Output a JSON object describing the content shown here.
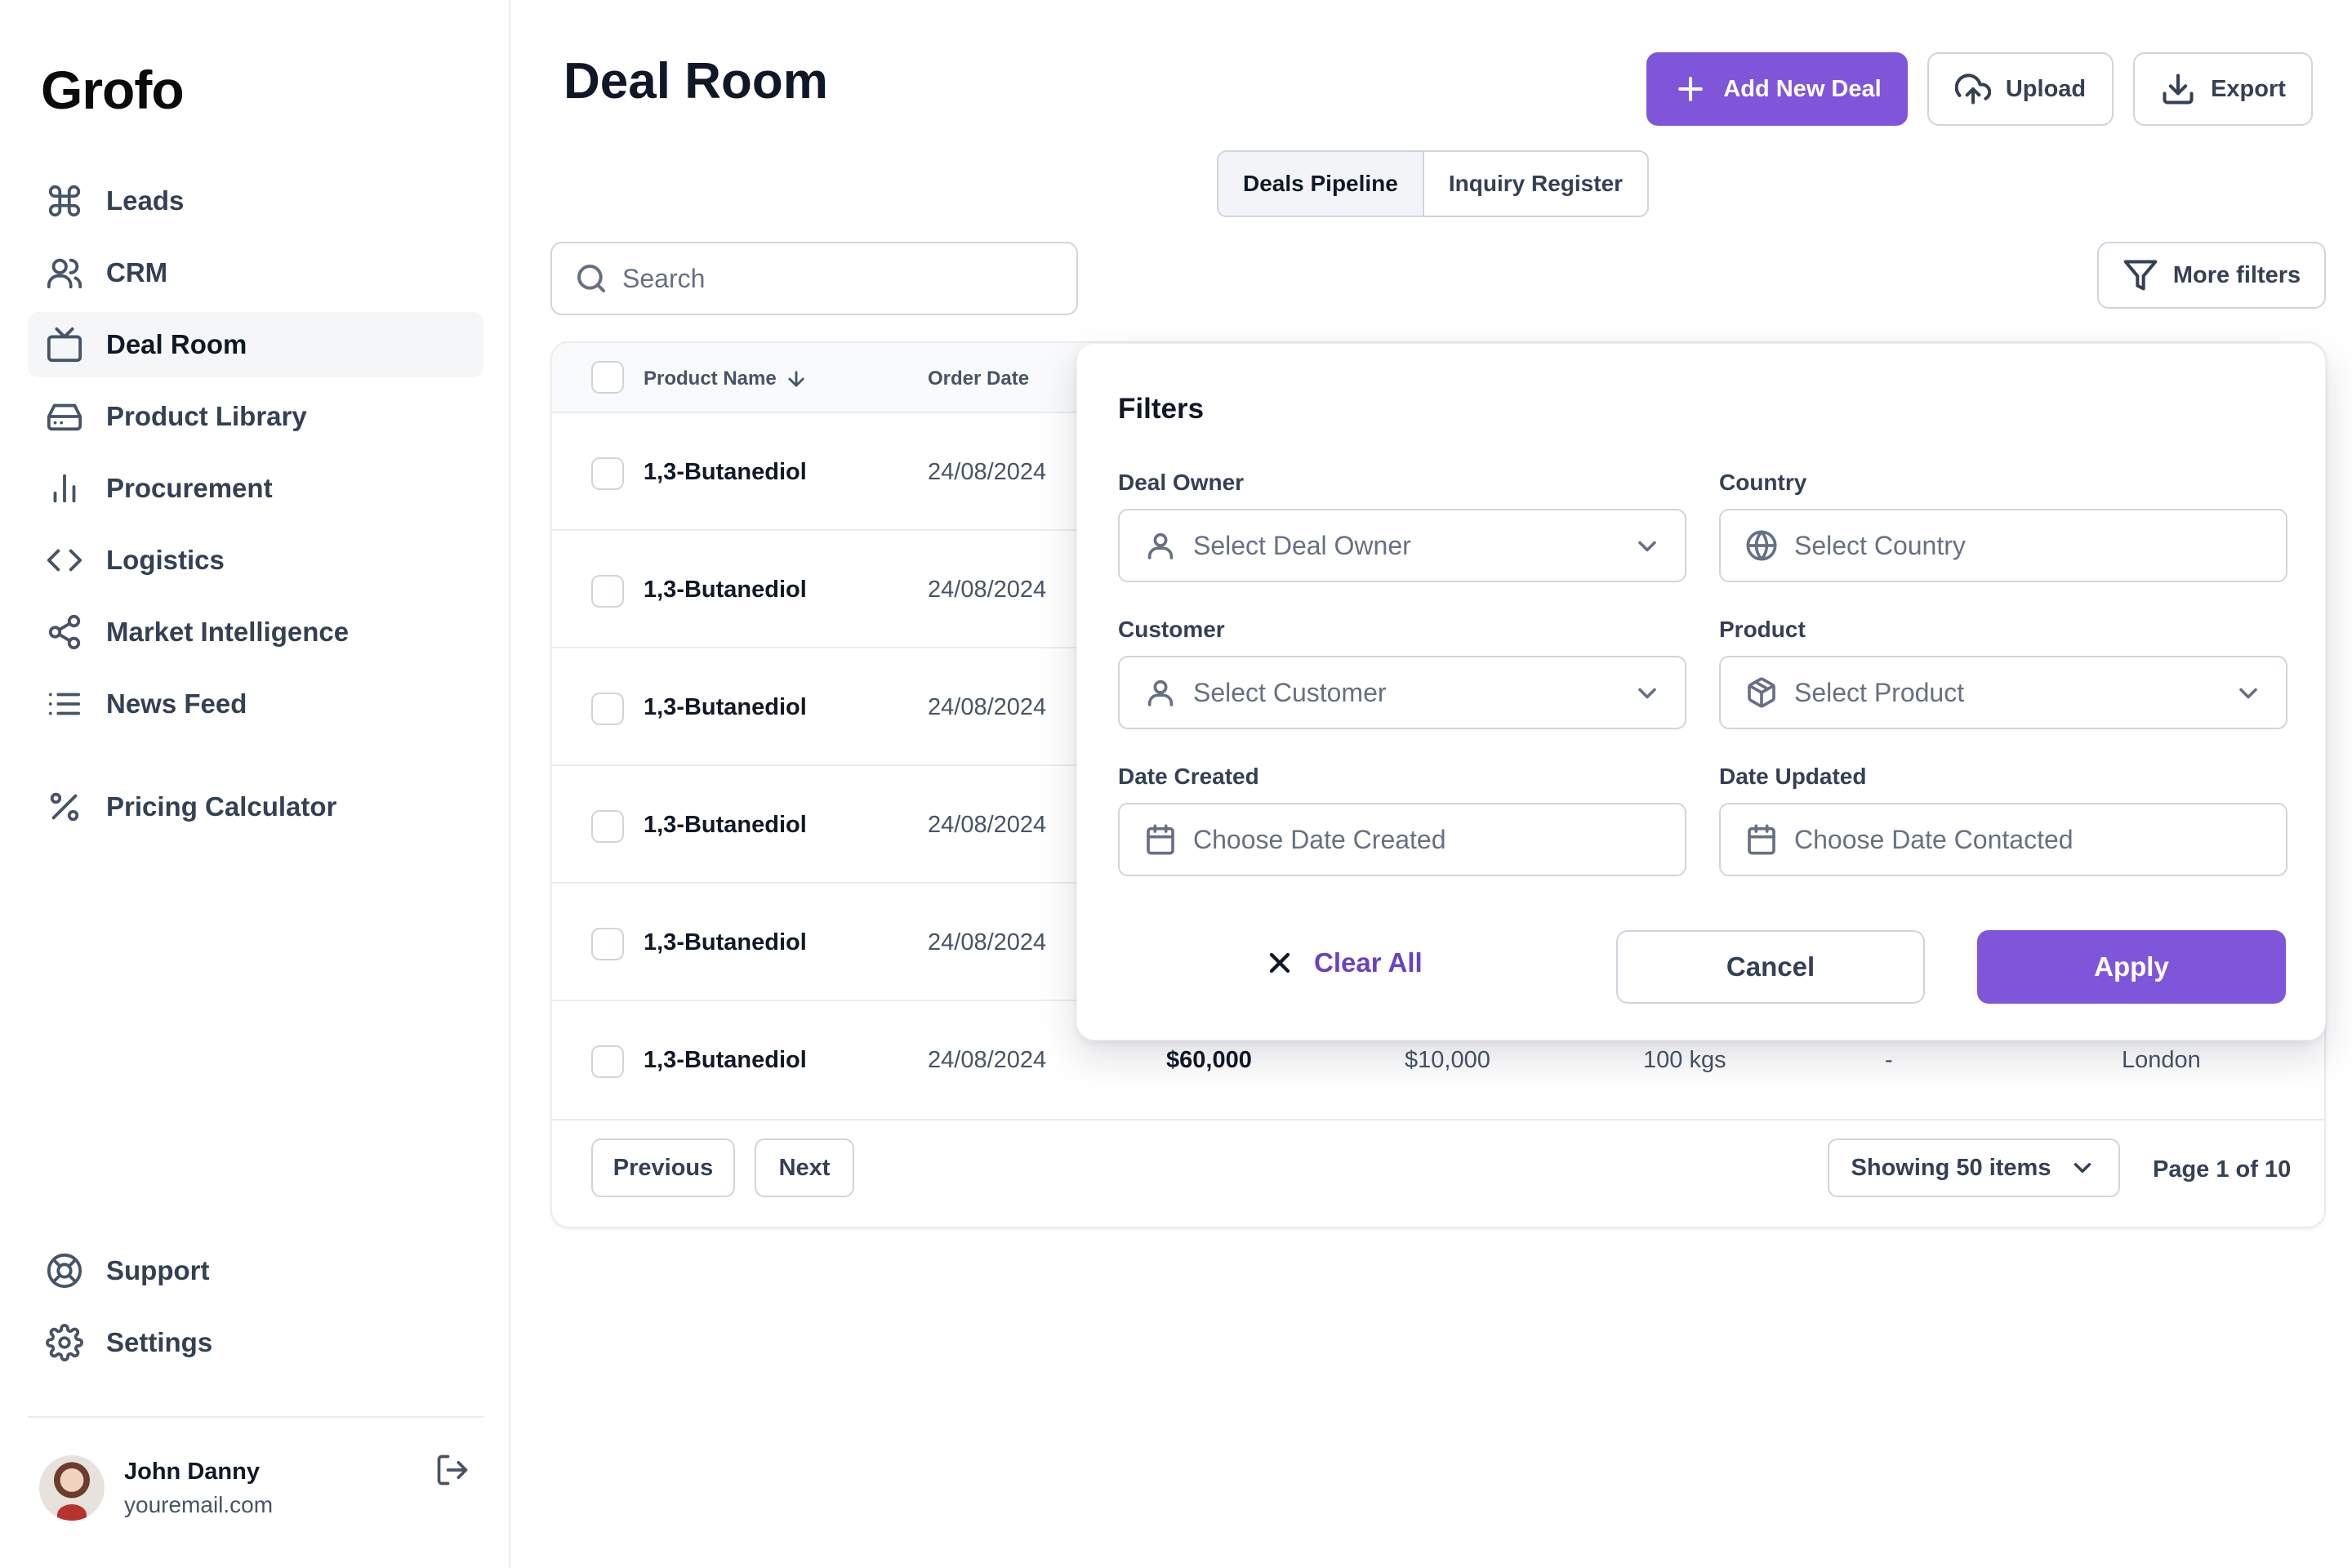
{
  "app": {
    "logo": "Grofo"
  },
  "sidebar": {
    "items": [
      {
        "label": "Leads",
        "icon": "command-icon"
      },
      {
        "label": "CRM",
        "icon": "users-icon"
      },
      {
        "label": "Deal Room",
        "icon": "tv-icon",
        "active": true
      },
      {
        "label": "Product Library",
        "icon": "hard-drive-icon"
      },
      {
        "label": "Procurement",
        "icon": "bar-chart-icon"
      },
      {
        "label": "Logistics",
        "icon": "code-icon"
      },
      {
        "label": "Market Intelligence",
        "icon": "share-icon"
      },
      {
        "label": "News Feed",
        "icon": "list-icon"
      },
      {
        "label": "Pricing Calculator",
        "icon": "percent-icon"
      }
    ],
    "bottom": [
      {
        "label": "Support",
        "icon": "life-buoy-icon"
      },
      {
        "label": "Settings",
        "icon": "settings-icon"
      }
    ],
    "user": {
      "name": "John Danny",
      "email": "youremail.com"
    }
  },
  "header": {
    "title": "Deal Room",
    "add_label": "Add New Deal",
    "upload_label": "Upload",
    "export_label": "Export"
  },
  "tabs": [
    {
      "label": "Deals Pipeline",
      "active": true
    },
    {
      "label": "Inquiry Register",
      "active": false
    }
  ],
  "search": {
    "placeholder": "Search"
  },
  "more_filters_label": "More filters",
  "table": {
    "columns": [
      "Product Name",
      "Order Date"
    ],
    "rows": [
      {
        "product": "1,3-Butanediol",
        "date": "24/08/2024"
      },
      {
        "product": "1,3-Butanediol",
        "date": "24/08/2024"
      },
      {
        "product": "1,3-Butanediol",
        "date": "24/08/2024"
      },
      {
        "product": "1,3-Butanediol",
        "date": "24/08/2024"
      },
      {
        "product": "1,3-Butanediol",
        "date": "24/08/2024"
      },
      {
        "product": "1,3-Butanediol",
        "date": "24/08/2024",
        "value": "$60,000",
        "amount": "$10,000",
        "qty": "100 kgs",
        "dash": "-",
        "city": "London"
      }
    ]
  },
  "pagination": {
    "previous": "Previous",
    "next": "Next",
    "showing": "Showing 50 items",
    "page": "Page 1 of 10"
  },
  "filters": {
    "title": "Filters",
    "deal_owner": {
      "label": "Deal Owner",
      "placeholder": "Select Deal Owner"
    },
    "country": {
      "label": "Country",
      "placeholder": "Select Country"
    },
    "customer": {
      "label": "Customer",
      "placeholder": "Select Customer"
    },
    "product": {
      "label": "Product",
      "placeholder": "Select Product"
    },
    "date_created": {
      "label": "Date Created",
      "placeholder": "Choose Date Created"
    },
    "date_updated": {
      "label": "Date Updated",
      "placeholder": "Choose Date Contacted"
    },
    "clear_all": "Clear All",
    "cancel": "Cancel",
    "apply": "Apply"
  },
  "colors": {
    "accent": "#7f56d9",
    "accent_text": "#6941c6",
    "border": "#d0d5dd"
  }
}
